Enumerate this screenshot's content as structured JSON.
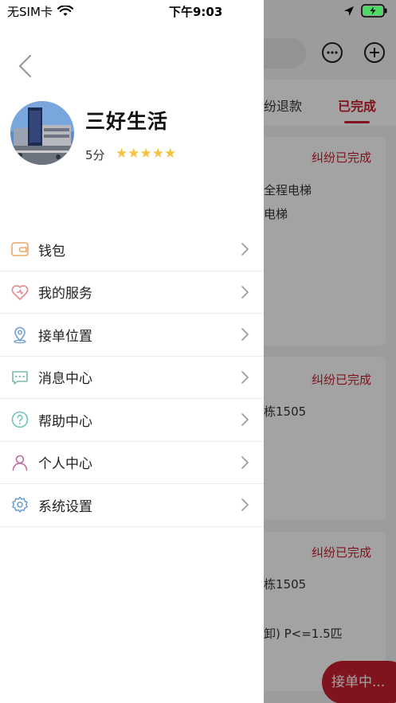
{
  "status_bar": {
    "carrier": "无SIM卡",
    "time": "下午9:03"
  },
  "profile": {
    "name": "三好生活",
    "score": "5分",
    "stars": "★★★★★"
  },
  "menu": {
    "items": [
      {
        "label": "钱包",
        "icon": "wallet-icon"
      },
      {
        "label": "我的服务",
        "icon": "heart-service-icon"
      },
      {
        "label": "接单位置",
        "icon": "location-pin-icon"
      },
      {
        "label": "消息中心",
        "icon": "message-icon"
      },
      {
        "label": "帮助中心",
        "icon": "help-icon"
      },
      {
        "label": "个人中心",
        "icon": "person-icon"
      },
      {
        "label": "系统设置",
        "icon": "gear-icon"
      }
    ]
  },
  "background": {
    "tabs": [
      "纷退款",
      "已完成"
    ],
    "cards": [
      {
        "status": "纠纷已完成",
        "lines": [
          "全程电梯",
          "电梯"
        ]
      },
      {
        "status": "纠纷已完成",
        "lines": [
          "栋1505"
        ]
      },
      {
        "status": "纠纷已完成",
        "lines": [
          "栋1505",
          "卸) P<=1.5匹"
        ]
      }
    ],
    "fab_label": "接单中..."
  },
  "colors": {
    "accent": "#c8202f",
    "star": "#f5c242"
  }
}
